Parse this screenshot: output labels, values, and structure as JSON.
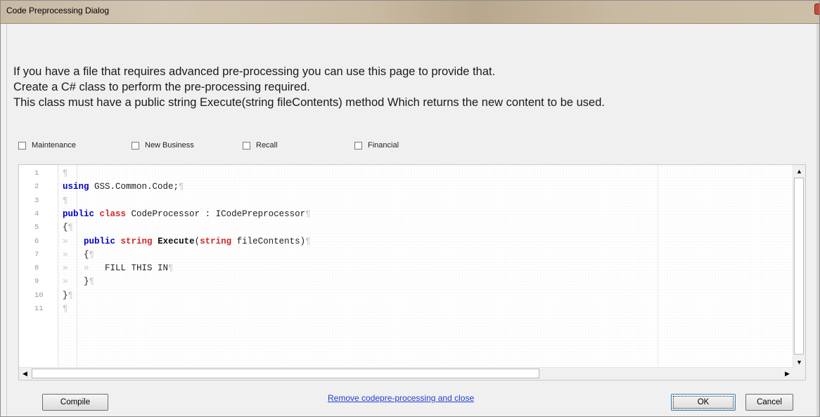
{
  "window": {
    "title": "Code Preprocessing Dialog"
  },
  "instructions": [
    "If you have a file that requires advanced pre-processing you can use this page to provide that.",
    "Create a C# class to perform the pre-processing required.",
    "This class must have a public string Execute(string fileContents) method Which returns the new content to be used."
  ],
  "checkboxes": [
    {
      "label": "Maintenance",
      "checked": false
    },
    {
      "label": "New Business",
      "checked": false
    },
    {
      "label": "Recall",
      "checked": false
    },
    {
      "label": "Financial",
      "checked": false
    }
  ],
  "editor": {
    "line_numbers": [
      "1",
      "2",
      "3",
      "4",
      "5",
      "6",
      "7",
      "8",
      "9",
      "10",
      "11"
    ],
    "lines": [
      [],
      [
        {
          "t": "using",
          "c": "kw"
        },
        {
          "t": " GSS.Common.Code;",
          "c": "pl"
        }
      ],
      [],
      [
        {
          "t": "public",
          "c": "kw"
        },
        {
          "t": " ",
          "c": "pl"
        },
        {
          "t": "class",
          "c": "kw2"
        },
        {
          "t": " CodeProcessor : ICodePreprocessor",
          "c": "pl"
        }
      ],
      [
        {
          "t": "{",
          "c": "pl"
        }
      ],
      [
        {
          "t": "»   ",
          "c": "ws"
        },
        {
          "t": "public",
          "c": "kw"
        },
        {
          "t": " ",
          "c": "pl"
        },
        {
          "t": "string",
          "c": "kw2"
        },
        {
          "t": " ",
          "c": "pl"
        },
        {
          "t": "Execute",
          "c": "id"
        },
        {
          "t": "(",
          "c": "pl"
        },
        {
          "t": "string",
          "c": "kw2"
        },
        {
          "t": " fileContents)",
          "c": "pl"
        }
      ],
      [
        {
          "t": "»   ",
          "c": "ws"
        },
        {
          "t": "{",
          "c": "pl"
        }
      ],
      [
        {
          "t": "»   »   ",
          "c": "ws"
        },
        {
          "t": "FILL THIS IN",
          "c": "pl"
        }
      ],
      [
        {
          "t": "»   ",
          "c": "ws"
        },
        {
          "t": "}",
          "c": "pl"
        }
      ],
      [
        {
          "t": "}",
          "c": "pl"
        }
      ],
      []
    ]
  },
  "buttons": {
    "compile": "Compile",
    "ok": "OK",
    "cancel": "Cancel"
  },
  "link": "Remove codepre-processing and close",
  "icons": {
    "close": "close-icon",
    "scroll_up": "scroll-up-arrow-icon",
    "scroll_down": "scroll-down-arrow-icon",
    "scroll_left": "scroll-left-arrow-icon",
    "scroll_right": "scroll-right-arrow-icon"
  }
}
